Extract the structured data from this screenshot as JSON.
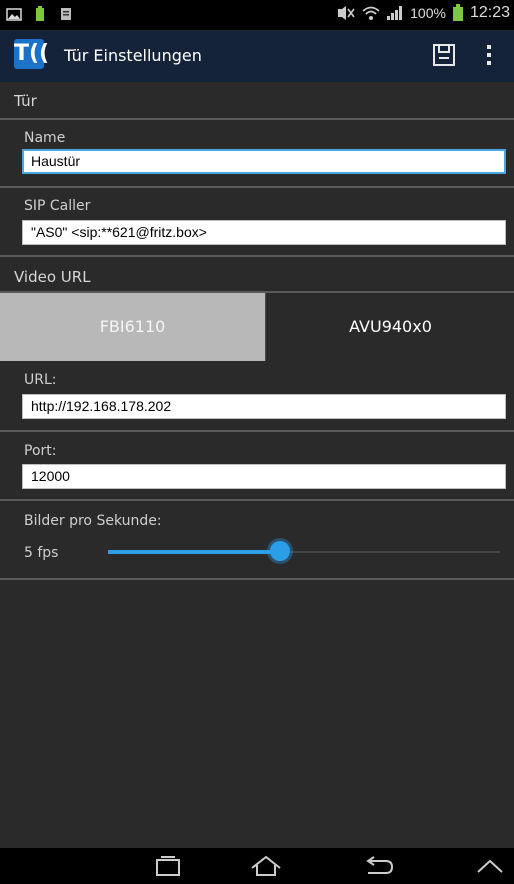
{
  "status": {
    "battery": "100%",
    "time": "12:23"
  },
  "header": {
    "title": "Tür Einstellungen",
    "logo_text": "T(("
  },
  "sections": {
    "door": "Tür",
    "video_url": "Video URL"
  },
  "name": {
    "label": "Name",
    "value": "Haustür"
  },
  "sip": {
    "label": "SIP Caller",
    "value": "\"AS0\" <sip:**621@fritz.box>"
  },
  "video": {
    "options": [
      "FBI6110",
      "AVU940x0"
    ],
    "selected": "FBI6110"
  },
  "url": {
    "label": "URL:",
    "value": "http://192.168.178.202"
  },
  "port": {
    "label": "Port:",
    "value": "12000"
  },
  "fps": {
    "label": "Bilder pro Sekunde:",
    "value_label": "5 fps",
    "slider_fraction": 0.44
  },
  "colors": {
    "accent": "#2c9ee8",
    "actionbar": "#14233a",
    "selected_segment": "#b8b8b8"
  },
  "icons": [
    "image-icon",
    "battery-small-icon",
    "doc-icon",
    "mute-icon",
    "wifi-icon",
    "signal-icon",
    "battery-icon",
    "save-icon",
    "overflow-menu-icon",
    "recent-apps-icon",
    "home-icon",
    "back-icon",
    "up-icon"
  ]
}
